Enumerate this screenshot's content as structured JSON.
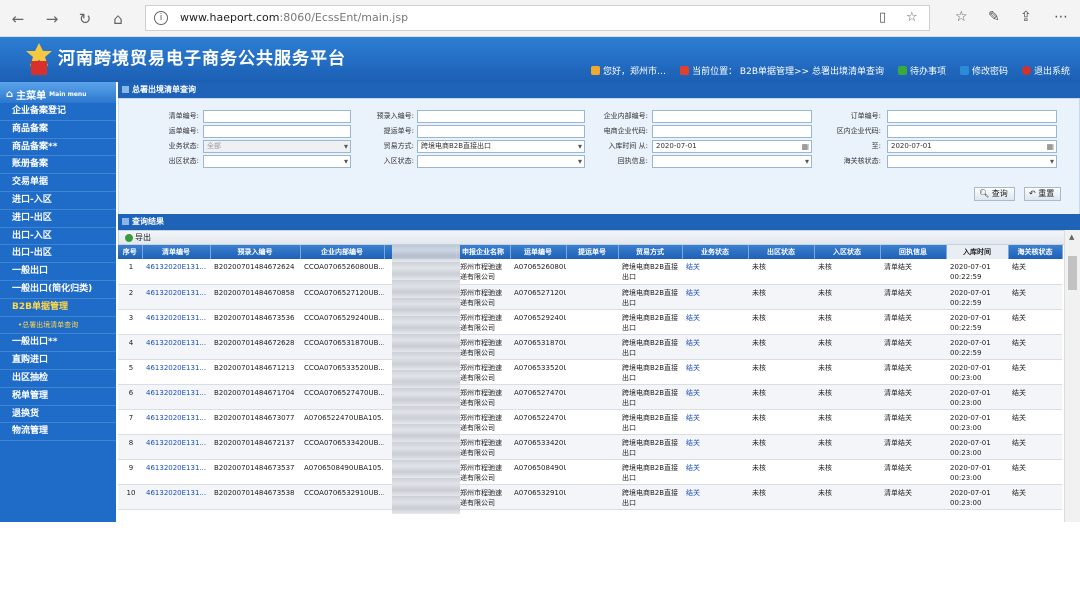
{
  "browser": {
    "url_main": "www.haeport.com",
    "url_rest": ":8060/EcssEnt/main.jsp",
    "info_icon": "i"
  },
  "banner": {
    "title": "河南跨境贸易电子商务公共服务平台",
    "greeting": "您好，郑州市…",
    "location": "当前位置： B2B单据管理>> 总署出境清单查询",
    "todo": "待办事项",
    "change_pwd": "修改密码",
    "logout": "退出系统",
    "colors": {
      "brand": "#1f63b8",
      "accent": "#ffd84a"
    }
  },
  "sidebar": {
    "head": "主菜单",
    "head_en": "Main menu",
    "items": [
      {
        "label": "企业备案登记"
      },
      {
        "label": "商品备案"
      },
      {
        "label": "商品备案**"
      },
      {
        "label": "账册备案"
      },
      {
        "label": "交易单据"
      },
      {
        "label": "进口-入区"
      },
      {
        "label": "进口-出区"
      },
      {
        "label": "出口-入区"
      },
      {
        "label": "出口-出区"
      },
      {
        "label": "一般出口"
      },
      {
        "label": "一般出口(简化归类)"
      },
      {
        "label": "B2B单据管理",
        "active": true
      },
      {
        "label": "•总署出境清单查询",
        "sub": true
      },
      {
        "label": "一般出口**"
      },
      {
        "label": "直购进口"
      },
      {
        "label": "出区抽检"
      },
      {
        "label": "税单管理"
      },
      {
        "label": "退换货"
      },
      {
        "label": "物流管理"
      }
    ]
  },
  "watermark": "大数跨境",
  "query": {
    "title": "总署出境清单查询",
    "labels": {
      "list_no": "清单编号:",
      "pre_no": "预录入编号:",
      "inner_no": "企业内部编号:",
      "order_no": "订单编号:",
      "waybill_no": "运单编号:",
      "bill_no": "提运单号:",
      "ec_code": "电商企业代码:",
      "zone_code": "区内企业代码:",
      "biz_status": "业务状态:",
      "trade_mode": "贸易方式:",
      "in_time": "入库时间 从:",
      "to": "至:",
      "out_status": "出区状态:",
      "in_status": "入区状态:",
      "receipt": "回执信息:",
      "customs_status": "海关核状态:"
    },
    "values": {
      "biz_status": "全部",
      "trade_mode": "跨境电商B2B直接出口",
      "from_date": "2020-07-01",
      "to_date": "2020-07-01"
    },
    "buttons": {
      "search": "查询",
      "reset": "重置"
    }
  },
  "results": {
    "title": "查询结果",
    "export": "导出",
    "columns": [
      "序号",
      "清单编号",
      "预录入编号",
      "企业内部编号",
      "",
      "申报企业名称",
      "运单编号",
      "提运单号",
      "贸易方式",
      "业务状态",
      "出区状态",
      "入区状态",
      "回执信息",
      "入库时间",
      "海关核状态"
    ],
    "rows": [
      {
        "idx": "1",
        "list_no": "46132020E131...",
        "pre_no": "B20200701484672624",
        "inner_no": "CCOA0706526080UB...",
        "company": "郑州市程驰速递有限公司",
        "waybill": "A0706526080U...",
        "bill": "",
        "trade": "跨境电商B2B直接出口",
        "biz": "结关",
        "out": "未核",
        "in": "未核",
        "receipt": "清单结关",
        "date": "2020-07-01",
        "time": "00:22:59",
        "customs": "结关"
      },
      {
        "idx": "2",
        "list_no": "46132020E131...",
        "pre_no": "B20200701484670858",
        "inner_no": "CCOA0706527120UB...",
        "company": "郑州市程驰速递有限公司",
        "waybill": "A0706527120U...",
        "bill": "",
        "trade": "跨境电商B2B直接出口",
        "biz": "结关",
        "out": "未核",
        "in": "未核",
        "receipt": "清单结关",
        "date": "2020-07-01",
        "time": "00:22:59",
        "customs": "结关"
      },
      {
        "idx": "3",
        "list_no": "46132020E131...",
        "pre_no": "B20200701484673536",
        "inner_no": "CCOA0706529240UB...",
        "company": "郑州市程驰速递有限公司",
        "waybill": "A0706529240U...",
        "bill": "",
        "trade": "跨境电商B2B直接出口",
        "biz": "结关",
        "out": "未核",
        "in": "未核",
        "receipt": "清单结关",
        "date": "2020-07-01",
        "time": "00:22:59",
        "customs": "结关"
      },
      {
        "idx": "4",
        "list_no": "46132020E131...",
        "pre_no": "B20200701484672628",
        "inner_no": "CCOA0706531870UB...",
        "company": "郑州市程驰速递有限公司",
        "waybill": "A0706531870U...",
        "bill": "",
        "trade": "跨境电商B2B直接出口",
        "biz": "结关",
        "out": "未核",
        "in": "未核",
        "receipt": "清单结关",
        "date": "2020-07-01",
        "time": "00:22:59",
        "customs": "结关"
      },
      {
        "idx": "5",
        "list_no": "46132020E131...",
        "pre_no": "B20200701484671213",
        "inner_no": "CCOA0706533520UB...",
        "company": "郑州市程驰速递有限公司",
        "waybill": "A0706533520U...",
        "bill": "",
        "trade": "跨境电商B2B直接出口",
        "biz": "结关",
        "out": "未核",
        "in": "未核",
        "receipt": "清单结关",
        "date": "2020-07-01",
        "time": "00:23:00",
        "customs": "结关"
      },
      {
        "idx": "6",
        "list_no": "46132020E131...",
        "pre_no": "B20200701484671704",
        "inner_no": "CCOA0706527470UB...",
        "company": "郑州市程驰速递有限公司",
        "waybill": "A0706527470U...",
        "bill": "",
        "trade": "跨境电商B2B直接出口",
        "biz": "结关",
        "out": "未核",
        "in": "未核",
        "receipt": "清单结关",
        "date": "2020-07-01",
        "time": "00:23:00",
        "customs": "结关"
      },
      {
        "idx": "7",
        "list_no": "46132020E131...",
        "pre_no": "B20200701484673077",
        "inner_no": "A0706522470UBA105...",
        "company": "郑州市程驰速递有限公司",
        "waybill": "A0706522470U...",
        "bill": "",
        "trade": "跨境电商B2B直接出口",
        "biz": "结关",
        "out": "未核",
        "in": "未核",
        "receipt": "清单结关",
        "date": "2020-07-01",
        "time": "00:23:00",
        "customs": "结关"
      },
      {
        "idx": "8",
        "list_no": "46132020E131...",
        "pre_no": "B20200701484672137",
        "inner_no": "CCOA0706533420UB...",
        "company": "郑州市程驰速递有限公司",
        "waybill": "A0706533420U...",
        "bill": "",
        "trade": "跨境电商B2B直接出口",
        "biz": "结关",
        "out": "未核",
        "in": "未核",
        "receipt": "清单结关",
        "date": "2020-07-01",
        "time": "00:23:00",
        "customs": "结关"
      },
      {
        "idx": "9",
        "list_no": "46132020E131...",
        "pre_no": "B20200701484673537",
        "inner_no": "A0706508490UBA105...",
        "company": "郑州市程驰速递有限公司",
        "waybill": "A0706508490U...",
        "bill": "",
        "trade": "跨境电商B2B直接出口",
        "biz": "结关",
        "out": "未核",
        "in": "未核",
        "receipt": "清单结关",
        "date": "2020-07-01",
        "time": "00:23:00",
        "customs": "结关"
      },
      {
        "idx": "10",
        "list_no": "46132020E131...",
        "pre_no": "B20200701484673538",
        "inner_no": "CCOA0706532910UB...",
        "company": "郑州市程驰速递有限公司",
        "waybill": "A0706532910U...",
        "bill": "",
        "trade": "跨境电商B2B直接出口",
        "biz": "结关",
        "out": "未核",
        "in": "未核",
        "receipt": "清单结关",
        "date": "2020-07-01",
        "time": "00:23:00",
        "customs": "结关"
      }
    ]
  }
}
